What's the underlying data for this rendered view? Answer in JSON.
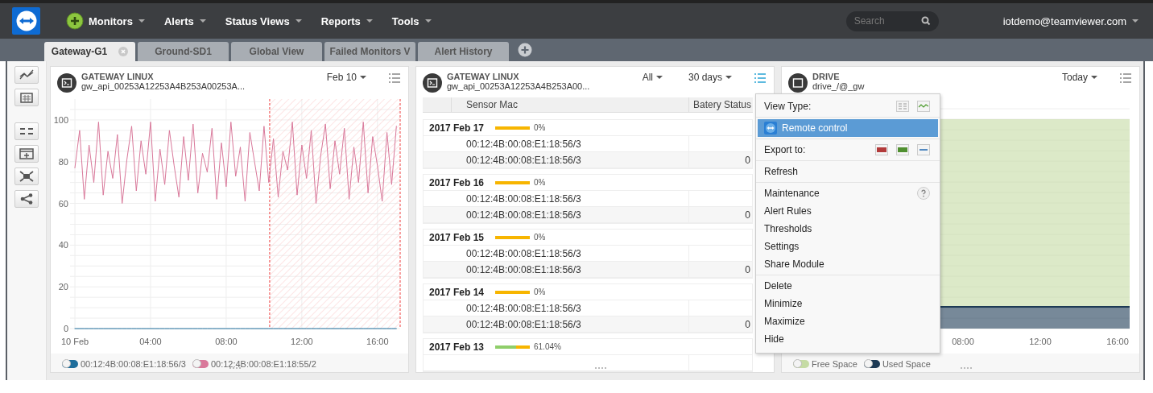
{
  "nav": {
    "menus": [
      {
        "label": "Monitors"
      },
      {
        "label": "Alerts"
      },
      {
        "label": "Status Views"
      },
      {
        "label": "Reports"
      },
      {
        "label": "Tools"
      }
    ],
    "search": {
      "placeholder": "Search"
    },
    "user": "iotdemo@teamviewer.com"
  },
  "tabs": [
    {
      "label": "Gateway-G1",
      "selected": true
    },
    {
      "label": "Ground-SD1",
      "selected": false
    },
    {
      "label": "Global View",
      "selected": false
    },
    {
      "label": "Failed Monitors V",
      "selected": false
    },
    {
      "label": "Alert History",
      "selected": false
    }
  ],
  "panels": [
    {
      "kind": "line",
      "title": "GATEWAY LINUX",
      "subtitle": "gw_api_00253A12253A4B253A00253A...",
      "range": "Feb 10",
      "chart_data": {
        "type": "line",
        "xlim": [
          0,
          17.2
        ],
        "ylim": [
          0,
          110
        ],
        "yticks": [
          0,
          20,
          40,
          60,
          80,
          100
        ],
        "xticks": [
          {
            "value": 0,
            "label": "10 Feb"
          },
          {
            "value": 4,
            "label": "04:00"
          },
          {
            "value": 8,
            "label": "08:00"
          },
          {
            "value": 12,
            "label": "12:00"
          },
          {
            "value": 16,
            "label": "16:00"
          }
        ],
        "grid": true,
        "bands": [
          {
            "axis": "x",
            "from": 10.3,
            "to": 17.2
          }
        ],
        "ref_lines": [
          {
            "axis": "x",
            "value": 10.3
          },
          {
            "axis": "x",
            "value": 17.2
          }
        ],
        "x": [
          0,
          0.25,
          0.5,
          0.75,
          1,
          1.25,
          1.5,
          1.75,
          2,
          2.25,
          2.5,
          2.75,
          3,
          3.25,
          3.5,
          3.75,
          4,
          4.25,
          4.5,
          4.75,
          5,
          5.25,
          5.5,
          5.75,
          6,
          6.25,
          6.5,
          6.75,
          7,
          7.25,
          7.5,
          7.75,
          8,
          8.25,
          8.5,
          8.75,
          9,
          9.25,
          9.5,
          9.75,
          10,
          10.25,
          10.5,
          10.75,
          11,
          11.25,
          11.5,
          11.75,
          12,
          12.25,
          12.5,
          12.75,
          13,
          13.25,
          13.5,
          13.75,
          14,
          14.25,
          14.5,
          14.75,
          15,
          15.25,
          15.5,
          15.75,
          16,
          16.25,
          16.5,
          16.75,
          17
        ],
        "series": [
          {
            "name": "00:12:4B:00:08:E1:18:56/3",
            "color": "#1f6e9c",
            "values": [
              0,
              0,
              0,
              0,
              0,
              0,
              0,
              0,
              0,
              0,
              0,
              0,
              0,
              0,
              0,
              0,
              0,
              0,
              0,
              0,
              0,
              0,
              0,
              0,
              0,
              0,
              0,
              0,
              0,
              0,
              0,
              0,
              0,
              0,
              0,
              0,
              0,
              0,
              0,
              0,
              0,
              0,
              0,
              0,
              0,
              0,
              0,
              0,
              0,
              0,
              0,
              0,
              0,
              0,
              0,
              0,
              0,
              0,
              0,
              0,
              0,
              0,
              0,
              0,
              0,
              0,
              0,
              0,
              0
            ]
          },
          {
            "name": "00:12:4B:00:08:E1:18:55/2",
            "color": "#d9789a",
            "values": [
              77,
              95,
              62,
              88,
              70,
              99,
              64,
              85,
              72,
              93,
              60,
              81,
              97,
              66,
              90,
              74,
              99,
              61,
              86,
              69,
              95,
              78,
              63,
              92,
              71,
              98,
              65,
              84,
              75,
              96,
              62,
              89,
              68,
              99,
              73,
              87,
              61,
              94,
              80,
              66,
              97,
              70,
              91,
              63,
              85,
              76,
              99,
              64,
              88,
              72,
              95,
              60,
              83,
              98,
              67,
              90,
              74,
              96,
              62,
              87,
              70,
              99,
              65,
              92,
              78,
              61,
              94,
              69,
              97
            ]
          }
        ]
      }
    },
    {
      "kind": "table",
      "title": "GATEWAY LINUX",
      "subtitle": "gw_api_00253A12253A4B253A00...",
      "filter": "All",
      "range": "30 days",
      "columns": [
        "Sensor Mac",
        "Batery Status"
      ],
      "groups": [
        {
          "date": "2017 Feb 17",
          "level": 0,
          "percent": "0%",
          "rows": [
            {
              "mac": "00:12:4B:00:08:E1:18:56/3"
            },
            {
              "mac": "00:12:4B:00:08:E1:18:56/3",
              "battery": "0"
            }
          ]
        },
        {
          "date": "2017 Feb 16",
          "level": 0,
          "percent": "0%",
          "rows": [
            {
              "mac": "00:12:4B:00:08:E1:18:56/3"
            },
            {
              "mac": "00:12:4B:00:08:E1:18:56/3",
              "battery": "0"
            }
          ]
        },
        {
          "date": "2017 Feb 15",
          "level": 0,
          "percent": "0%",
          "rows": [
            {
              "mac": "00:12:4B:00:08:E1:18:56/3"
            },
            {
              "mac": "00:12:4B:00:08:E1:18:56/3",
              "battery": "0"
            }
          ]
        },
        {
          "date": "2017 Feb 14",
          "level": 0,
          "percent": "0%",
          "rows": [
            {
              "mac": "00:12:4B:00:08:E1:18:56/3"
            },
            {
              "mac": "00:12:4B:00:08:E1:18:56/3",
              "battery": "0"
            }
          ]
        },
        {
          "date": "2017 Feb 13",
          "level": 0.6104,
          "percent": "61.04%"
        }
      ]
    },
    {
      "kind": "area",
      "title": "DRIVE",
      "subtitle": "drive_/@_gw",
      "range": "Today",
      "xticks": [
        "08:00",
        "12:00",
        "16:00"
      ],
      "legend": [
        {
          "label": "Free Space",
          "color": "#c5dba4"
        },
        {
          "label": "Used Space",
          "color": "#1d3a55"
        }
      ]
    }
  ],
  "menu": {
    "sections": [
      [
        {
          "kind": "view-type",
          "label": "View Type:",
          "selected": false
        }
      ],
      [
        {
          "kind": "action",
          "label": "Remote control",
          "selected": true
        }
      ],
      [
        {
          "kind": "export",
          "label": "Export to:",
          "selected": false
        }
      ],
      [
        {
          "kind": "plain",
          "label": "Refresh",
          "selected": false
        }
      ],
      [
        {
          "kind": "help",
          "label": "Maintenance",
          "selected": false
        },
        {
          "kind": "plain",
          "label": "Alert Rules",
          "selected": false
        },
        {
          "kind": "plain",
          "label": "Thresholds",
          "selected": false
        },
        {
          "kind": "plain",
          "label": "Settings",
          "selected": false
        },
        {
          "kind": "plain",
          "label": "Share Module",
          "selected": false
        }
      ],
      [
        {
          "kind": "plain",
          "label": "Delete",
          "selected": false
        },
        {
          "kind": "plain",
          "label": "Minimize",
          "selected": false
        },
        {
          "kind": "plain",
          "label": "Maximize",
          "selected": false
        },
        {
          "kind": "plain",
          "label": "Hide",
          "selected": false
        }
      ]
    ]
  }
}
